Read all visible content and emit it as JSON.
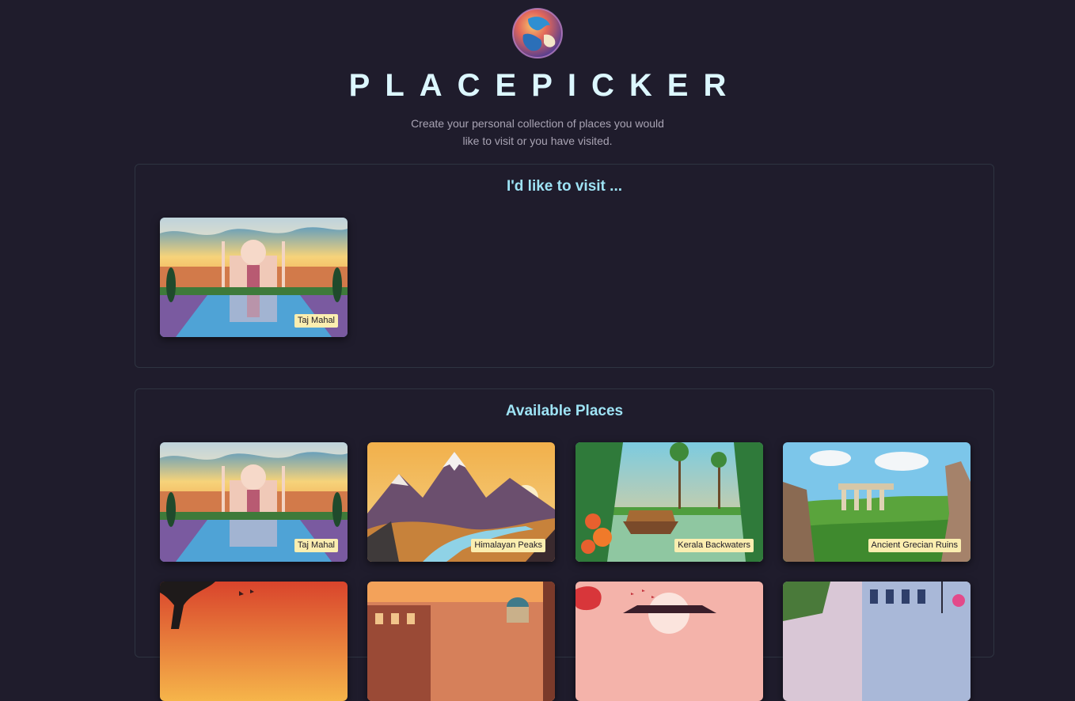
{
  "app": {
    "title": "PLACEPICKER",
    "subtitle": "Create your personal collection of places you would like to visit or you have visited."
  },
  "wishlist": {
    "heading": "I'd like to visit ...",
    "places": [
      {
        "title": "Taj Mahal"
      }
    ]
  },
  "available": {
    "heading": "Available Places",
    "places": [
      {
        "title": "Taj Mahal"
      },
      {
        "title": "Himalayan Peaks"
      },
      {
        "title": "Kerala Backwaters"
      },
      {
        "title": "Ancient Grecian Ruins"
      },
      {
        "title": ""
      },
      {
        "title": ""
      },
      {
        "title": ""
      },
      {
        "title": ""
      }
    ]
  },
  "colors": {
    "background": "#1f1c2c",
    "accent": "#9ee3f5",
    "label_bg": "#fbeeb0"
  }
}
